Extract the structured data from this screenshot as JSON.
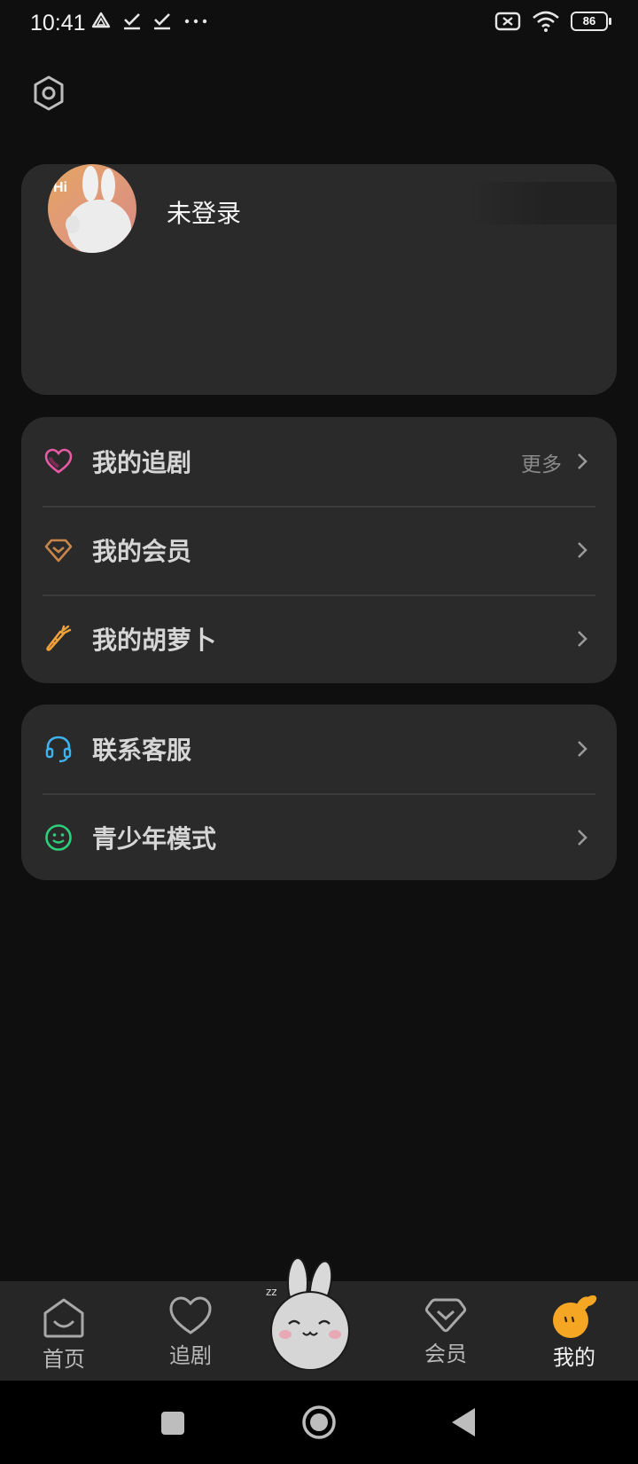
{
  "status_bar": {
    "time": "10:41",
    "battery": "86"
  },
  "profile": {
    "login_status": "未登录",
    "avatar_badge": "Hi"
  },
  "menu_group_1": [
    {
      "label": "我的追剧",
      "more": "更多",
      "icon": "heart-icon",
      "icon_color": "#e85aa6"
    },
    {
      "label": "我的会员",
      "icon": "vip-diamond-icon",
      "icon_color": "#c8854a"
    },
    {
      "label": "我的胡萝卜",
      "icon": "carrot-icon",
      "icon_color": "#f0a13a"
    }
  ],
  "menu_group_2": [
    {
      "label": "联系客服",
      "icon": "headset-icon",
      "icon_color": "#3fb2f0"
    },
    {
      "label": "青少年模式",
      "icon": "smiley-icon",
      "icon_color": "#2fcf7a"
    }
  ],
  "bottom_nav": [
    {
      "label": "首页",
      "icon": "home-icon"
    },
    {
      "label": "追剧",
      "icon": "heart-outline-icon"
    },
    {
      "label": "会员",
      "icon": "vip-icon"
    },
    {
      "label": "我的",
      "icon": "profile-bunny-icon",
      "active": true
    }
  ],
  "colors": {
    "background": "#0f0f0f",
    "card": "#2a2a2a",
    "accent_orange": "#f5a623"
  }
}
